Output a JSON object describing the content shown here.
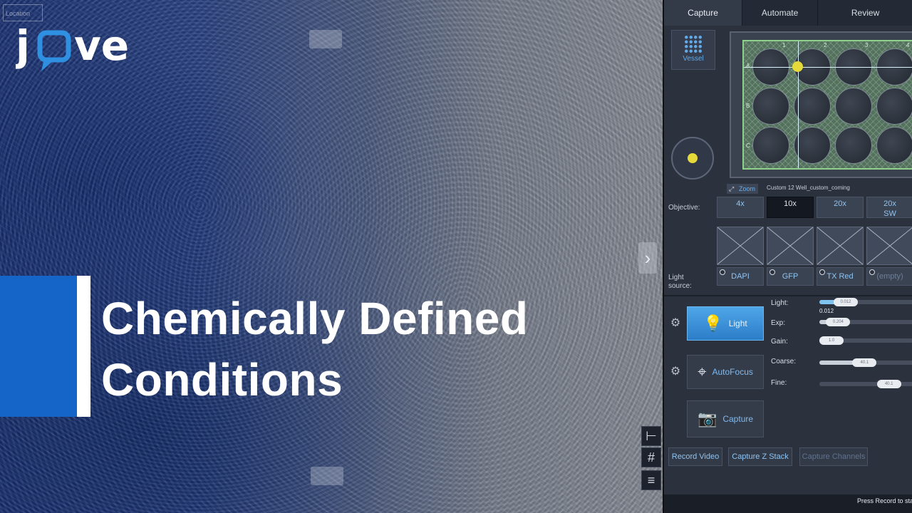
{
  "brand": {
    "logo_text": "jove"
  },
  "title": {
    "line1": "Chemically Defined",
    "line2": "Conditions"
  },
  "scope": {
    "location_label": "Location"
  },
  "tabs": [
    {
      "label": "Capture",
      "active": true
    },
    {
      "label": "Automate",
      "active": false
    },
    {
      "label": "Review",
      "active": false
    }
  ],
  "vessel": {
    "button_label": "Vessel",
    "zoom_label": "Zoom",
    "name": "Custom 12 Well_custom_coming",
    "col_labels": [
      "1",
      "2",
      "3",
      "4"
    ],
    "row_labels": [
      "A",
      "B",
      "C"
    ]
  },
  "objective": {
    "label": "Objective:",
    "options": [
      {
        "label": "4x",
        "selected": false
      },
      {
        "label": "10x",
        "selected": true
      },
      {
        "label": "20x",
        "selected": false
      },
      {
        "label": "20x\nSW",
        "selected": false
      }
    ]
  },
  "light_source": {
    "label": "Light\nsource:",
    "options": [
      "DAPI",
      "GFP",
      "TX Red",
      "(empty)"
    ]
  },
  "controls": {
    "light_button": "Light",
    "autofocus_button": "AutoFocus",
    "capture_button": "Capture",
    "light_value": "0.012"
  },
  "sliders": [
    {
      "label": "Light:",
      "level": 0.28,
      "thumb": "0.012"
    },
    {
      "label": "Exp:",
      "level": 0.2,
      "thumb": "0.204"
    },
    {
      "label": "Gain:",
      "level": 0.1,
      "thumb": "1.0"
    },
    {
      "label": "Coarse:",
      "level": 0.48,
      "thumb": "40.1"
    },
    {
      "label": "Fine:",
      "level": 0.74,
      "thumb": "40.1"
    }
  ],
  "bottom_buttons": [
    {
      "label": "Record Video",
      "enabled": true
    },
    {
      "label": "Capture Z Stack",
      "enabled": true
    },
    {
      "label": "Capture Channels",
      "enabled": false
    }
  ],
  "status": {
    "text": "Press Record to sta"
  },
  "colors": {
    "accent_blue": "#1565c9",
    "selected_marker": "#e6da3b",
    "plate_border": "#8fd18a"
  }
}
